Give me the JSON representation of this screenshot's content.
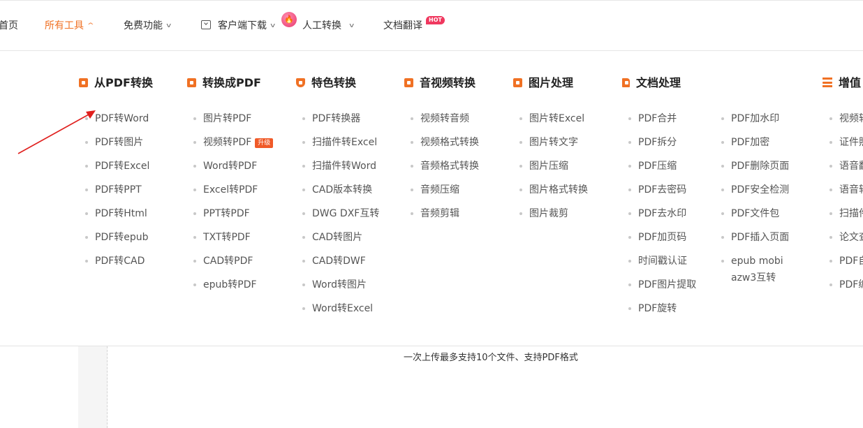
{
  "nav": {
    "items": [
      {
        "label": "首页",
        "active": false
      },
      {
        "label": "所有工具",
        "active": true
      },
      {
        "label": "免费功能",
        "active": false
      },
      {
        "label": "客户端下载",
        "active": false
      },
      {
        "label": "人工转换",
        "active": false
      },
      {
        "label": "文档翻译",
        "active": false
      }
    ],
    "hot_badge": "HOT",
    "fire_icon": "fire-icon",
    "download_icon": "download-icon",
    "accent_color": "#f07124"
  },
  "menu": {
    "columns": [
      {
        "title": "从PDF转换",
        "icon": "pdf-convert-icon",
        "items": [
          "PDF转Word",
          "PDF转图片",
          "PDF转Excel",
          "PDF转PPT",
          "PDF转Html",
          "PDF转epub",
          "PDF转CAD"
        ]
      },
      {
        "title": "转换成PDF",
        "icon": "to-pdf-icon",
        "items": [
          "图片转PDF",
          "视频转PDF",
          "Word转PDF",
          "Excel转PDF",
          "PPT转PDF",
          "TXT转PDF",
          "CAD转PDF",
          "epub转PDF"
        ],
        "badge": "升级"
      },
      {
        "title": "特色转换",
        "icon": "shield-star-icon",
        "items": [
          "PDF转换器",
          "扫描件转Excel",
          "扫描件转Word",
          "CAD版本转换",
          "DWG DXF互转",
          "CAD转图片",
          "CAD转DWF",
          "Word转图片",
          "Word转Excel"
        ]
      },
      {
        "title": "音视频转换",
        "icon": "media-play-icon",
        "items": [
          "视频转音频",
          "视频格式转换",
          "音频格式转换",
          "音频压缩",
          "音频剪辑"
        ]
      },
      {
        "title": "图片处理",
        "icon": "image-icon",
        "items": [
          "图片转Excel",
          "图片转文字",
          "图片压缩",
          "图片格式转换",
          "图片裁剪"
        ]
      },
      {
        "title": "文档处理",
        "icon": "document-icon",
        "items": [
          "PDF合并",
          "PDF拆分",
          "PDF压缩",
          "PDF去密码",
          "PDF去水印",
          "PDF加页码",
          "时间戳认证",
          "PDF图片提取",
          "PDF旋转"
        ]
      },
      {
        "title": "",
        "icon": "",
        "items": [
          "PDF加水印",
          "PDF加密",
          "PDF删除页面",
          "PDF安全检测",
          "PDF文件包",
          "PDF插入页面",
          "epub mobi azw3互转"
        ]
      },
      {
        "title": "增值",
        "icon": "list-icon",
        "items": [
          "视频转",
          "证件照",
          "语音翻",
          "语音转",
          "扫描件",
          "论文查",
          "PDF自",
          "PDF编"
        ]
      }
    ]
  },
  "upload": {
    "note": "一次上传最多支持10个文件、支持PDF格式"
  }
}
